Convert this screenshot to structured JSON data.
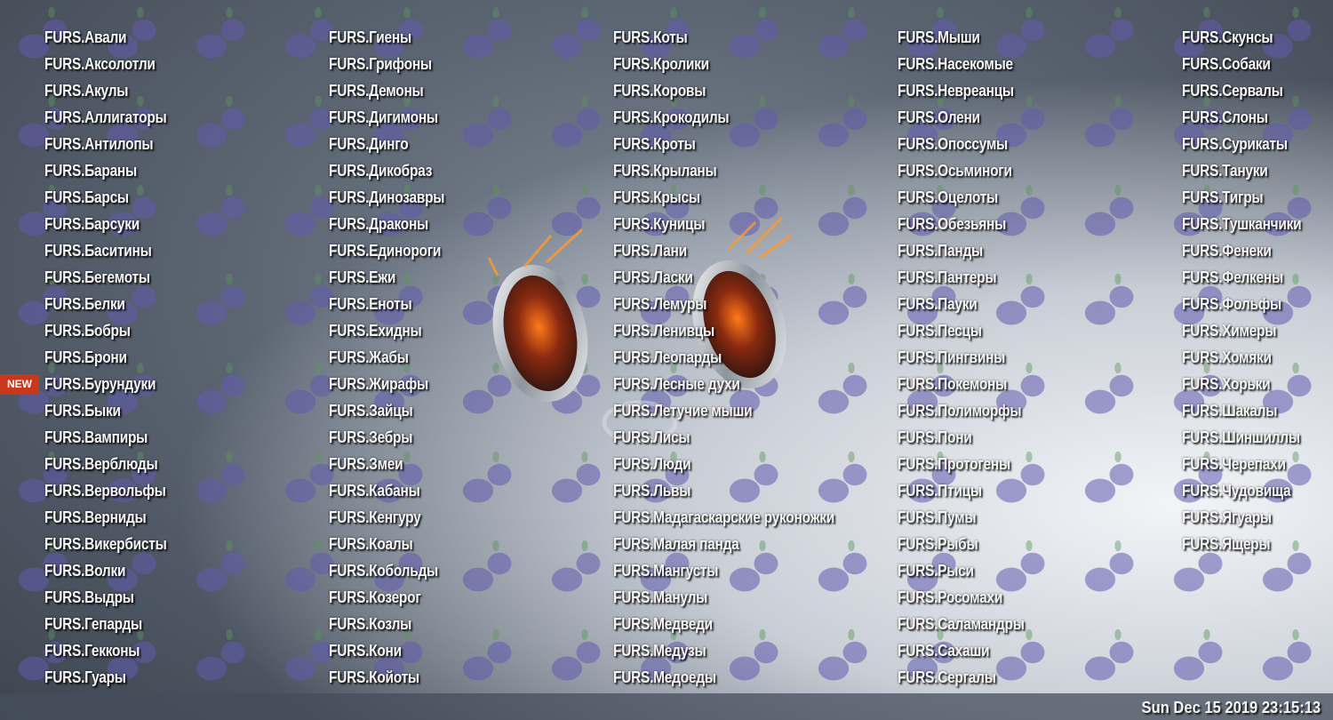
{
  "desktop": {
    "new_badge": "NEW",
    "clock": "Sun Dec 15 2019 23:15:13",
    "columns": [
      [
        "FURS.Авали",
        "FURS.Аксолотли",
        "FURS.Акулы",
        "FURS.Аллигаторы",
        "FURS.Антилопы",
        "FURS.Бараны",
        "FURS.Барсы",
        "FURS.Барсуки",
        "FURS.Баситины",
        "FURS.Бегемоты",
        "FURS.Белки",
        "FURS.Бобры",
        "FURS.Брони",
        "FURS.Бурундуки",
        "FURS.Быки",
        "FURS.Вампиры",
        "FURS.Верблюды",
        "FURS.Вервольфы",
        "FURS.Верниды",
        "FURS.Викербисты",
        "FURS.Волки",
        "FURS.Выдры",
        "FURS.Гепарды",
        "FURS.Гекконы",
        "FURS.Гуары"
      ],
      [
        "FURS.Гиены",
        "FURS.Грифоны",
        "FURS.Демоны",
        "FURS.Дигимоны",
        "FURS.Динго",
        "FURS.Дикобраз",
        "FURS.Динозавры",
        "FURS.Драконы",
        "FURS.Единороги",
        "FURS.Ежи",
        "FURS.Еноты",
        "FURS.Ехидны",
        "FURS.Жабы",
        "FURS.Жирафы",
        "FURS.Зайцы",
        "FURS.Зебры",
        "FURS.Змеи",
        "FURS.Кабаны",
        "FURS.Кенгуру",
        "FURS.Коалы",
        "FURS.Кобольды",
        "FURS.Козерог",
        "FURS.Козлы",
        "FURS.Кони",
        "FURS.Койоты"
      ],
      [
        "FURS.Коты",
        "FURS.Кролики",
        "FURS.Коровы",
        "FURS.Крокодилы",
        "FURS.Кроты",
        "FURS.Крыланы",
        "FURS.Крысы",
        "FURS.Куницы",
        "FURS.Лани",
        "FURS.Ласки",
        "FURS.Лемуры",
        "FURS.Ленивцы",
        "FURS.Леопарды",
        "FURS.Лесные духи",
        "FURS.Летучие мыши",
        "FURS.Лисы",
        "FURS.Люди",
        "FURS.Львы",
        "FURS.Мадагаскарские руконожки",
        "FURS.Малая панда",
        "FURS.Мангусты",
        "FURS.Манулы",
        "FURS.Медведи",
        "FURS.Медузы",
        "FURS.Медоеды"
      ],
      [
        "FURS.Мыши",
        "FURS.Насекомые",
        "FURS.Невреанцы",
        "FURS.Олени",
        "FURS.Опоссумы",
        "FURS.Осьминоги",
        "FURS.Оцелоты",
        "FURS.Обезьяны",
        "FURS.Панды",
        "FURS.Пантеры",
        "FURS.Пауки",
        "FURS.Песцы",
        "FURS.Пингвины",
        "FURS.Покемоны",
        "FURS.Полиморфы",
        "FURS.Пони",
        "FURS.Протогены",
        "FURS.Птицы",
        "FURS.Пумы",
        "FURS.Рыбы",
        "FURS.Рыси",
        "FURS.Росомахи",
        "FURS.Саламандры",
        "FURS.Сахаши",
        "FURS.Сергалы"
      ],
      [
        "FURS.Скунсы",
        "FURS.Собаки",
        "FURS.Сервалы",
        "FURS.Слоны",
        "FURS.Сурикаты",
        "FURS.Тануки",
        "FURS.Тигры",
        "FURS.Тушканчики",
        "FURS.Фенеки",
        "FURS.Фелкены",
        "FURS.Фольфы",
        "FURS.Химеры",
        "FURS.Хомяки",
        "FURS.Хорьки",
        "FURS.Шакалы",
        "FURS.Шиншиллы",
        "FURS.Черепахи",
        "FURS.Чудовища",
        "FURS.Ягуары",
        "FURS.Ящеры"
      ]
    ]
  }
}
